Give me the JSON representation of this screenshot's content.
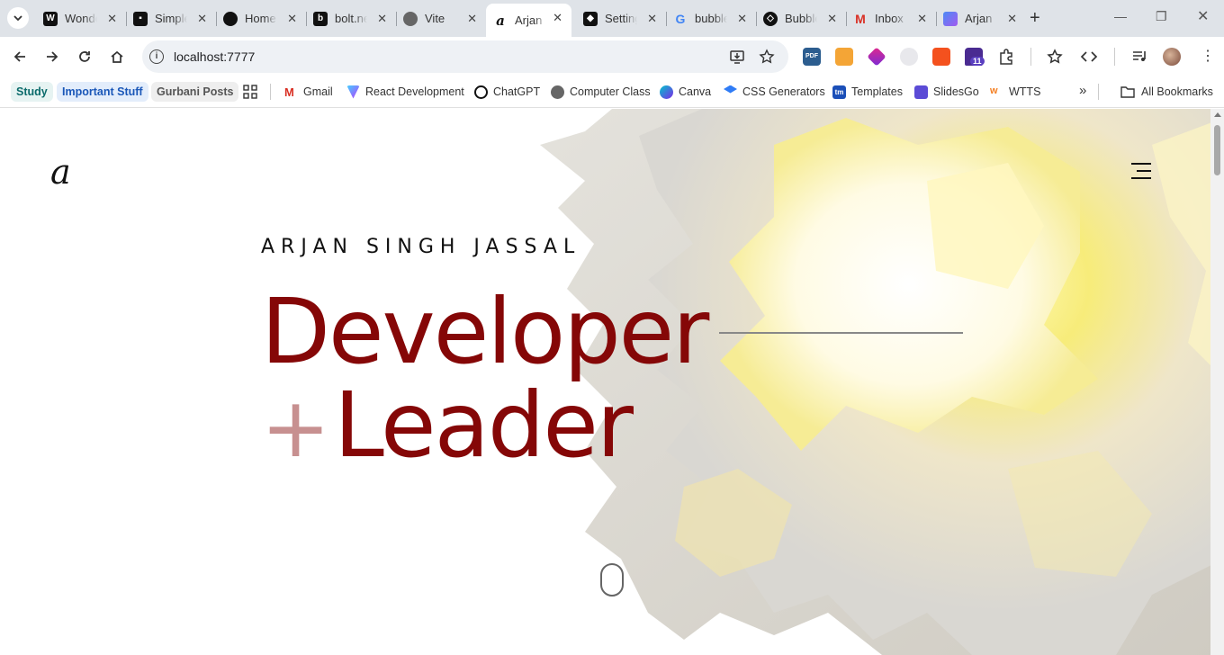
{
  "browser": {
    "tabs": [
      {
        "title": "Wonderful",
        "icon": "w-logo-icon"
      },
      {
        "title": "Simple",
        "icon": "square-logo-icon"
      },
      {
        "title": "Home",
        "icon": "circle-logo-icon"
      },
      {
        "title": "bolt.new",
        "icon": "bolt-logo-icon"
      },
      {
        "title": "Vite",
        "icon": "globe-icon"
      },
      {
        "title": "Arjan",
        "icon": "a-logo-icon",
        "active": true
      },
      {
        "title": "Settings",
        "icon": "settings-logo-icon"
      },
      {
        "title": "bubble",
        "icon": "google-logo-icon"
      },
      {
        "title": "Bubble",
        "icon": "codepen-logo-icon"
      },
      {
        "title": "Inbox",
        "icon": "gmail-icon"
      },
      {
        "title": "Arjan",
        "icon": "app-logo-icon"
      }
    ],
    "url": "localhost:7777",
    "bookmarks": [
      {
        "label": "Study",
        "kind": "chip",
        "color": "#0b6b6b"
      },
      {
        "label": "Important Stuff",
        "kind": "chip",
        "color": "#1a57b8"
      },
      {
        "label": "Gurbani Posts",
        "kind": "chip",
        "color": "#555555"
      },
      {
        "label": "Gmail",
        "icon": "gmail-icon"
      },
      {
        "label": "React Development",
        "icon": "vite-icon"
      },
      {
        "label": "ChatGPT",
        "icon": "chatgpt-icon"
      },
      {
        "label": "Computer Class",
        "icon": "globe-icon"
      },
      {
        "label": "Canva",
        "icon": "canva-icon"
      },
      {
        "label": "CSS Generators",
        "icon": "layers-icon"
      },
      {
        "label": "Templates",
        "icon": "tm-icon"
      },
      {
        "label": "SlidesGo",
        "icon": "slidesgo-icon"
      },
      {
        "label": "WTTS",
        "icon": "wtts-icon"
      }
    ],
    "all_bookmarks": "All Bookmarks",
    "extension_badge": "11"
  },
  "site": {
    "logo": "a",
    "name": "ARJAN SINGH JASSAL",
    "headline_line1": "Developer",
    "headline_plus": "+",
    "headline_line2": "Leader",
    "colors": {
      "accent": "#850707",
      "plus": "#c79090",
      "flower": "#f7ec7a"
    }
  }
}
